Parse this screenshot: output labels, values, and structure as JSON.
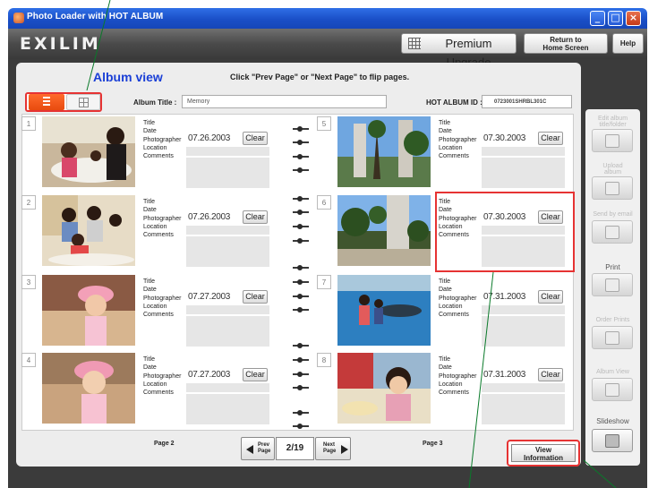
{
  "window": {
    "title": "Photo Loader with HOT ALBUM"
  },
  "header": {
    "logo": "EXILIM",
    "premium_label": "Premium Upgrade",
    "home_line1": "Return to",
    "home_line2": "Home Screen",
    "help_label": "Help"
  },
  "main": {
    "heading": "Album view",
    "hint": "Click \"Prev Page\" or \"Next Page\" to flip pages.",
    "album_title_label": "Album Title :",
    "album_title_value": "Memory",
    "hot_album_id_label": "HOT ALBUM ID :",
    "hot_album_id_value": "0723001SHRBL301C"
  },
  "field_labels": {
    "title": "Title",
    "date": "Date",
    "photographer": "Photographer",
    "location": "Location",
    "comments": "Comments"
  },
  "clear_label": "Clear",
  "entries": [
    {
      "num": "1",
      "date": "07.26.2003"
    },
    {
      "num": "2",
      "date": "07.26.2003"
    },
    {
      "num": "3",
      "date": "07.27.2003"
    },
    {
      "num": "4",
      "date": "07.27.2003"
    },
    {
      "num": "5",
      "date": "07.30.2003"
    },
    {
      "num": "6",
      "date": "07.30.2003"
    },
    {
      "num": "7",
      "date": "07.31.2003"
    },
    {
      "num": "8",
      "date": "07.31.2003"
    }
  ],
  "pager": {
    "left_page": "Page 2",
    "right_page": "Page 3",
    "prev_line1": "Prev",
    "prev_line2": "Page",
    "current": "2/19",
    "next_line1": "Next",
    "next_line2": "Page",
    "view_info_line1": "View",
    "view_info_line2": "Information"
  },
  "sidebar": {
    "edit_line1": "Edit album",
    "edit_line2": "title/folder",
    "upload_line1": "Upload",
    "upload_line2": "album",
    "email": "Send by email",
    "print": "Print",
    "order": "Order Prints",
    "album_view": "Album View",
    "slideshow": "Slideshow"
  },
  "colors": {
    "accent": "#1a3fd6",
    "highlight": "#e63333",
    "titlebar": "#1a4fc7"
  }
}
